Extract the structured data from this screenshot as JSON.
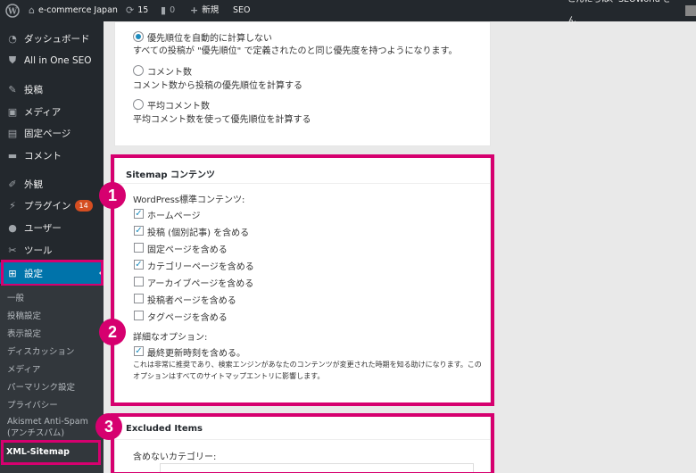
{
  "adminbar": {
    "site_name": "e-commerce Japan",
    "updates_count": "15",
    "comments_count": "0",
    "new_label": "新規",
    "seo_label": "SEO",
    "greeting": "こんにちは、SEOWorld さん"
  },
  "sidebar": {
    "items": [
      {
        "label": "ダッシュボード",
        "icon": "dashboard-icon"
      },
      {
        "label": "All in One SEO",
        "icon": "shield-icon"
      },
      {
        "label": "投稿",
        "icon": "pin-icon"
      },
      {
        "label": "メディア",
        "icon": "media-icon"
      },
      {
        "label": "固定ページ",
        "icon": "page-icon"
      },
      {
        "label": "コメント",
        "icon": "comment-icon"
      },
      {
        "label": "外観",
        "icon": "brush-icon"
      },
      {
        "label": "プラグイン",
        "icon": "plugin-icon",
        "badge": "14"
      },
      {
        "label": "ユーザー",
        "icon": "user-icon"
      },
      {
        "label": "ツール",
        "icon": "wrench-icon"
      },
      {
        "label": "設定",
        "icon": "settings-icon"
      }
    ],
    "submenu": [
      "一般",
      "投稿設定",
      "表示設定",
      "ディスカッション",
      "メディア",
      "パーマリンク設定",
      "プライバシー",
      "Akismet Anti-Spam (アンチスパム)",
      "XML-Sitemap"
    ]
  },
  "priority": {
    "options": [
      {
        "label": "優先順位を自動的に計算しない",
        "desc": "すべての投稿が \"優先順位\" で定義されたのと同じ優先度を持つようになります。",
        "selected": true
      },
      {
        "label": "コメント数",
        "desc": "コメント数から投稿の優先順位を計算する",
        "selected": false
      },
      {
        "label": "平均コメント数",
        "desc": "平均コメント数を使って優先順位を計算する",
        "selected": false
      }
    ]
  },
  "sitemap_content": {
    "title": "Sitemap コンテンツ",
    "standard_heading": "WordPress標準コンテンツ:",
    "checkboxes": [
      {
        "label": "ホームページ",
        "checked": true
      },
      {
        "label": "投稿 (個別記事) を含める",
        "checked": true
      },
      {
        "label": "固定ページを含める",
        "checked": false
      },
      {
        "label": "カテゴリーページを含める",
        "checked": true
      },
      {
        "label": "アーカイブページを含める",
        "checked": false
      },
      {
        "label": "投稿者ページを含める",
        "checked": false
      },
      {
        "label": "タグページを含める",
        "checked": false
      }
    ],
    "advanced_heading": "詳細なオプション:",
    "lastmod_label": "最終更新時刻を含める。",
    "lastmod_note_1": "これは非常に推奨であり、検索エンジンがあなたのコンテンツが変更された時期を知る助けになります。この",
    "lastmod_note_2": "オプションはすべてのサイトマップエントリに影響します。"
  },
  "excluded": {
    "title": "Excluded Items",
    "categories_label": "含めないカテゴリー:"
  },
  "badges": [
    "1",
    "2",
    "3"
  ],
  "colors": {
    "highlight": "#d6006f",
    "wp_dark": "#23282d",
    "wp_blue": "#0073aa"
  }
}
